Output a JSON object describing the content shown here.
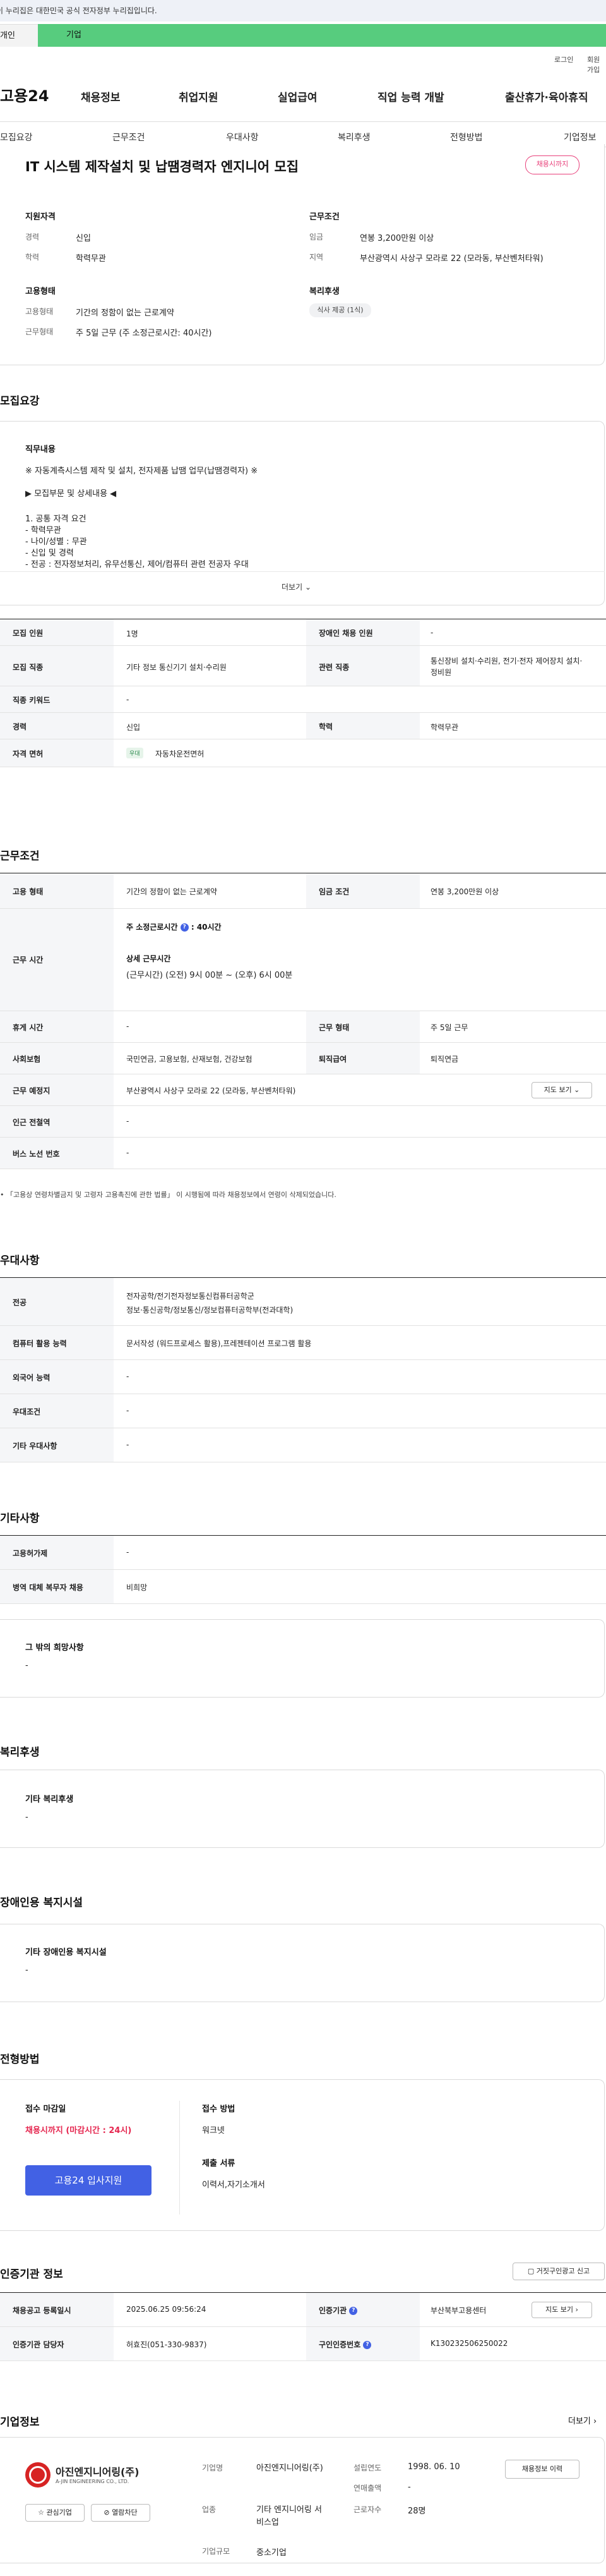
{
  "gov_banner": "이 누리집은 대한민국 공식 전자정부 누리집입니다.",
  "tabs": {
    "individual": "개인",
    "business": "기업"
  },
  "util": {
    "login": "로그인",
    "join": "회원가입"
  },
  "brand": {
    "logo": "고용24",
    "accent": "#57cc7e"
  },
  "gnb": [
    "채용정보",
    "취업지원",
    "실업급여",
    "직업 능력 개발",
    "출산휴가·육아휴직"
  ],
  "subnav": [
    "모집요강",
    "근무조건",
    "우대사항",
    "복리후생",
    "전형방법",
    "기업정보"
  ],
  "job": {
    "title": "IT 시스템 제작설치 및 납땜경력자 엔지니어 모집",
    "status_badge": "채용시까지",
    "qual_title": "지원자격",
    "qual": [
      {
        "k": "경력",
        "v": "신입"
      },
      {
        "k": "학력",
        "v": "학력무관"
      }
    ],
    "cond_title": "근무조건",
    "cond": [
      {
        "k": "임금",
        "v": "연봉 3,200만원 이상"
      },
      {
        "k": "지역",
        "v": "부산광역시 사상구 모라로 22 (모라동, 부산벤처타워)"
      }
    ],
    "emp_title": "고용형태",
    "emp": [
      {
        "k": "고용형태",
        "v": "기간의 정함이 없는 근로계약"
      },
      {
        "k": "근무형태",
        "v": "주 5일 근무 (주 소정근로시간: 40시간)"
      }
    ],
    "welfare_title": "복리후생",
    "welfare_chip": "식사 제공 (1식)"
  },
  "recruit": {
    "section": "모집요강",
    "job_label": "직무내용",
    "lines": [
      "※ 자동계측시스템 제작 및 설치, 전자제품 납땜 업무(납땜경력자) ※",
      "▶ 모집부문 및 상세내용 ◀",
      "1. 공통 자격 요건",
      "- 학력무관",
      "- 나이/성별 : 무관",
      "- 신입 및 경력",
      "- 전공 : 전자정보처리, 유무선통신, 제어/컴퓨터 관련 전공자 우대"
    ],
    "more": "더보기",
    "table": [
      {
        "k1": "모집 인원",
        "v1": "1명",
        "k2": "장애인 채용 인원",
        "v2": "-"
      },
      {
        "k1": "모집 직종",
        "v1": "기타 정보 통신기기 설치·수리원",
        "k2": "관련 직종",
        "v2": "통신장비 설치·수리원, 전기·전자 제어장치 설치·정비원"
      },
      {
        "k1": "직종 키워드",
        "v1": "-"
      },
      {
        "k1": "경력",
        "v1": "신입",
        "k2": "학력",
        "v2": "학력무관"
      },
      {
        "k1": "자격 면허",
        "v1_tag": "우대",
        "v1": "자동차운전면허"
      }
    ]
  },
  "work": {
    "section": "근무조건",
    "emp_type": {
      "k": "고용 형태",
      "v": "기간의 정함이 없는 근로계약"
    },
    "wage": {
      "k": "임금 조건",
      "v": "연봉 3,200만원 이상"
    },
    "hours_k": "근무 시간",
    "hours_weekly_label": "주 소정근로시간",
    "hours_weekly_value": "40시간",
    "hours_detail_label": "상세 근무시간",
    "hours_detail": "(근무시간) (오전) 9시 00분 ~ (오후) 6시 00분",
    "rest": {
      "k": "휴게 시간",
      "v": "-"
    },
    "work_form": {
      "k": "근무 형태",
      "v": "주 5일 근무"
    },
    "insurance": {
      "k": "사회보험",
      "v": "국민연금, 고용보험, 산재보험, 건강보험"
    },
    "retire": {
      "k": "퇴직급여",
      "v": "퇴직연금"
    },
    "place": {
      "k": "근무 예정지",
      "v": "부산광역시 사상구 모라로 22 (모라동, 부산벤처타워)"
    },
    "map_btn": "지도 보기",
    "subway": {
      "k": "인근 전철역",
      "v": "-"
    },
    "bus": {
      "k": "버스 노선 번호",
      "v": "-"
    },
    "note": "「고용상 연령차별금지 및 고령자 고용촉진에 관한 법률」 이 시행됨에 따라 채용정보에서 연령이 삭제되었습니다."
  },
  "pref": {
    "section": "우대사항",
    "rows": [
      {
        "k": "전공",
        "v": "전자공학/전기전자정보통신컴퓨터공학군",
        "v2": "정보·통신공학/정보통신/정보컴퓨터공학부(전과대학)"
      },
      {
        "k": "컴퓨터 활용 능력",
        "v": "문서작성 (워드프로세스 활용),프레젠테이션 프로그램 활용"
      },
      {
        "k": "외국어 능력",
        "v": "-"
      },
      {
        "k": "우대조건",
        "v": "-"
      },
      {
        "k": "기타 우대사항",
        "v": "-"
      }
    ]
  },
  "etc": {
    "section": "기타사항",
    "rows": [
      {
        "k": "고용허가제",
        "v": "-"
      },
      {
        "k": "병역 대체 복무자 채용",
        "v": "비희망"
      }
    ],
    "other_label": "그 밖의 희망사항",
    "other_value": "-"
  },
  "benefits": {
    "section": "복리후생",
    "label": "기타 복리후생",
    "value": "-"
  },
  "disability": {
    "section": "장애인용 복지시설",
    "label": "기타 장애인용 복지시설",
    "value": "-"
  },
  "process": {
    "section": "전형방법",
    "deadline_label": "접수 마감일",
    "deadline_value": "채용시까지 (마감시간 : 24시)",
    "apply_btn": "고용24 입사지원",
    "method_label": "접수 방법",
    "method_value": "워크넷",
    "docs_label": "제출 서류",
    "docs_value": "이력서,자기소개서",
    "highlight": "#e5254e"
  },
  "agency": {
    "section": "인증기관 정보",
    "report_btn": "거짓구인광고 신고",
    "rows": [
      {
        "k1": "채용공고 등록일시",
        "v1": "2025.06.25 09:56:24",
        "k2": "인증기관",
        "v2": "부산북부고용센터",
        "btn": "지도 보기"
      },
      {
        "k1": "인증기관 담당자",
        "v1": "허효진(051-330-9837)",
        "k2": "구인인증번호",
        "v2": "K130232506250022"
      }
    ]
  },
  "company": {
    "section": "기업정보",
    "more": "더보기",
    "logo_ko": "아진엔지니어링(주)",
    "logo_en": "A-JIN ENGINEERING CO., LTD.",
    "fav_btn": "관심기업",
    "block_btn": "열람차단",
    "fields": [
      {
        "k": "기업명",
        "v": "아진엔지니어링(주)"
      },
      {
        "k": "업종",
        "v": "기타 엔지니어링 서비스업"
      },
      {
        "k": "기업규모",
        "v": "중소기업"
      }
    ],
    "fields2": [
      {
        "k": "설립연도",
        "v": "1998. 06. 10"
      },
      {
        "k": "연매출액",
        "v": "-"
      },
      {
        "k": "근로자수",
        "v": "28명"
      }
    ],
    "jobs_btn": "채용정보 이력"
  }
}
